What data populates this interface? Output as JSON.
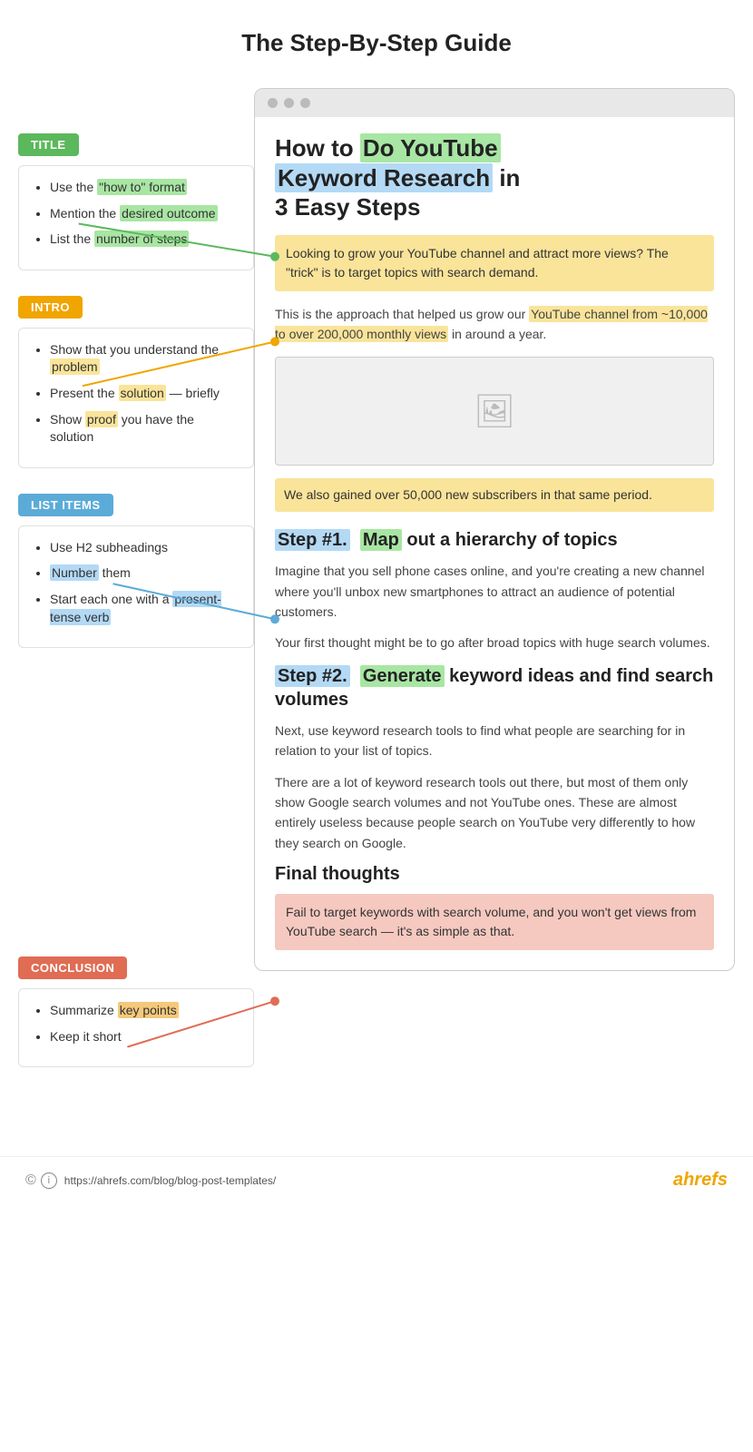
{
  "page": {
    "title": "The Step-By-Step Guide"
  },
  "sidebar": {
    "title_label": "TITLE",
    "title_items": [
      {
        "text": "Use the ",
        "highlight": "\"how to\" format",
        "highlight_class": "highlight-green"
      },
      {
        "text": "Mention the ",
        "highlight": "desired outcome",
        "highlight_class": "highlight-green"
      },
      {
        "text": "List the ",
        "highlight": "number of steps",
        "highlight_class": "highlight-green"
      }
    ],
    "intro_label": "INTRO",
    "intro_items": [
      {
        "text": "Show that you understand the ",
        "highlight": "problem",
        "highlight_class": "highlight-yellow"
      },
      {
        "text": "Present the ",
        "highlight": "solution",
        "highlight_class": "highlight-yellow",
        "suffix": " — briefly"
      },
      {
        "text": "Show ",
        "highlight": "proof",
        "highlight_class": "highlight-yellow",
        "suffix": " you have the solution"
      }
    ],
    "list_label": "LIST ITEMS",
    "list_items": [
      {
        "text": "Use H2 subheadings"
      },
      {
        "text": "",
        "highlight": "Number",
        "highlight_class": "highlight-blue",
        "suffix": " them"
      },
      {
        "text": "Start each one with a ",
        "highlight": "present-tense verb",
        "highlight_class": "highlight-blue"
      }
    ],
    "conclusion_label": "CONCLUSION",
    "conclusion_items": [
      {
        "text": "Summarize ",
        "highlight": "key points",
        "highlight_class": "highlight-orange"
      },
      {
        "text": "Keep it short"
      }
    ]
  },
  "article": {
    "title_part1": "How to",
    "title_highlight1": "Do YouTube",
    "title_part2": "Keyword Research",
    "title_highlight2": "in",
    "title_part3": "3 Easy Steps",
    "intro_highlight": "Looking to grow your YouTube channel and attract more views?  The \"trick\" is to target topics with search demand.",
    "intro_text1": "This is the approach that helped us grow our YouTube channel from ~10,000 to over 200,000 monthly views in around a year.",
    "subscribers_text": "We also gained over 50,000 new subscribers in that same period.",
    "step1_heading": "Step #1.   Map  out a hierarchy of topics",
    "step1_text1": "Imagine that you sell phone cases online, and you're creating a new channel where you'll unbox new smartphones to attract an audience of potential customers.",
    "step1_text2": "Your first thought might be to go after broad topics with huge search volumes.",
    "step2_heading": "Step #2.   Generate  keyword ideas and find search volumes",
    "step2_text1": "Next, use keyword research tools to find what people are searching for in relation to your list of topics.",
    "step2_text2": "There are a lot of keyword research tools out there, but most of them only show Google search volumes and not YouTube ones. These are almost entirely useless because people search on YouTube very differently to how they search on Google.",
    "conclusion_heading": "Final thoughts",
    "conclusion_highlight": "Fail to target keywords with search volume, and you won't get views from YouTube search — it's as simple as that."
  },
  "footer": {
    "url": "https://ahrefs.com/blog/blog-post-templates/",
    "brand": "ahrefs"
  }
}
